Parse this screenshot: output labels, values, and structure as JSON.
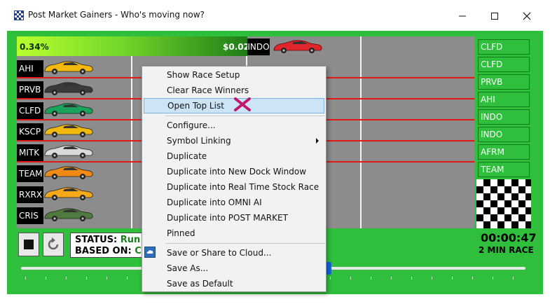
{
  "window": {
    "title": "Post Market Gainers - Who's moving now?",
    "controls": [
      "minimize",
      "maximize",
      "close"
    ]
  },
  "leader": {
    "percent": "0.34%",
    "amount": "$0.02",
    "symbol": "INDO",
    "car_color": "#e0262a"
  },
  "lanes": [
    {
      "symbol": "AHI",
      "car_color": "#f2b90c"
    },
    {
      "symbol": "PRVB",
      "car_color": "#3a3a3a"
    },
    {
      "symbol": "CLFD",
      "car_color": "#1aa35a"
    },
    {
      "symbol": "KSCP",
      "car_color": "#f2b90c"
    },
    {
      "symbol": "MITK",
      "car_color": "#d9d9d9"
    },
    {
      "symbol": "TEAM",
      "car_color": "#f08a14"
    },
    {
      "symbol": "RXRX",
      "car_color": "#f5a81a"
    },
    {
      "symbol": "CRIS",
      "car_color": "#4f7a3d"
    }
  ],
  "leaderboard": [
    "CLFD",
    "CLFD",
    "PRVB",
    "AHI",
    "INDO",
    "INDO",
    "AFRM",
    "TEAM"
  ],
  "status": {
    "status_label": "STATUS:",
    "status_value": "Run",
    "based_on_label": "BASED ON:",
    "based_on_value": "C"
  },
  "timer": {
    "time": "00:00:47",
    "race_length": "2 MIN RACE"
  },
  "slider": {
    "position": 0.61
  },
  "context_menu": {
    "items": [
      {
        "label": "Show Race Setup"
      },
      {
        "label": "Clear Race Winners"
      },
      {
        "label": "Open Top List",
        "highlighted": true
      },
      {
        "label": "Configure..."
      },
      {
        "label": "Symbol Linking",
        "submenu": true
      },
      {
        "label": "Duplicate"
      },
      {
        "label": "Duplicate into New Dock Window"
      },
      {
        "label": "Duplicate into Real Time Stock Race"
      },
      {
        "label": "Duplicate into OMNI AI"
      },
      {
        "label": "Duplicate into POST MARKET"
      },
      {
        "label": "Pinned"
      },
      {
        "label": "Save or Share to Cloud...",
        "icon": "cloud-share-icon"
      },
      {
        "label": "Save As..."
      },
      {
        "label": "Save as Default"
      }
    ]
  },
  "colors": {
    "background_green": "#2fbf3c",
    "track_gray": "#8c8c8c",
    "lane_separator": "#e01818",
    "menu_highlight": "#cde4f7",
    "cursor_mark": "#c0186a"
  }
}
